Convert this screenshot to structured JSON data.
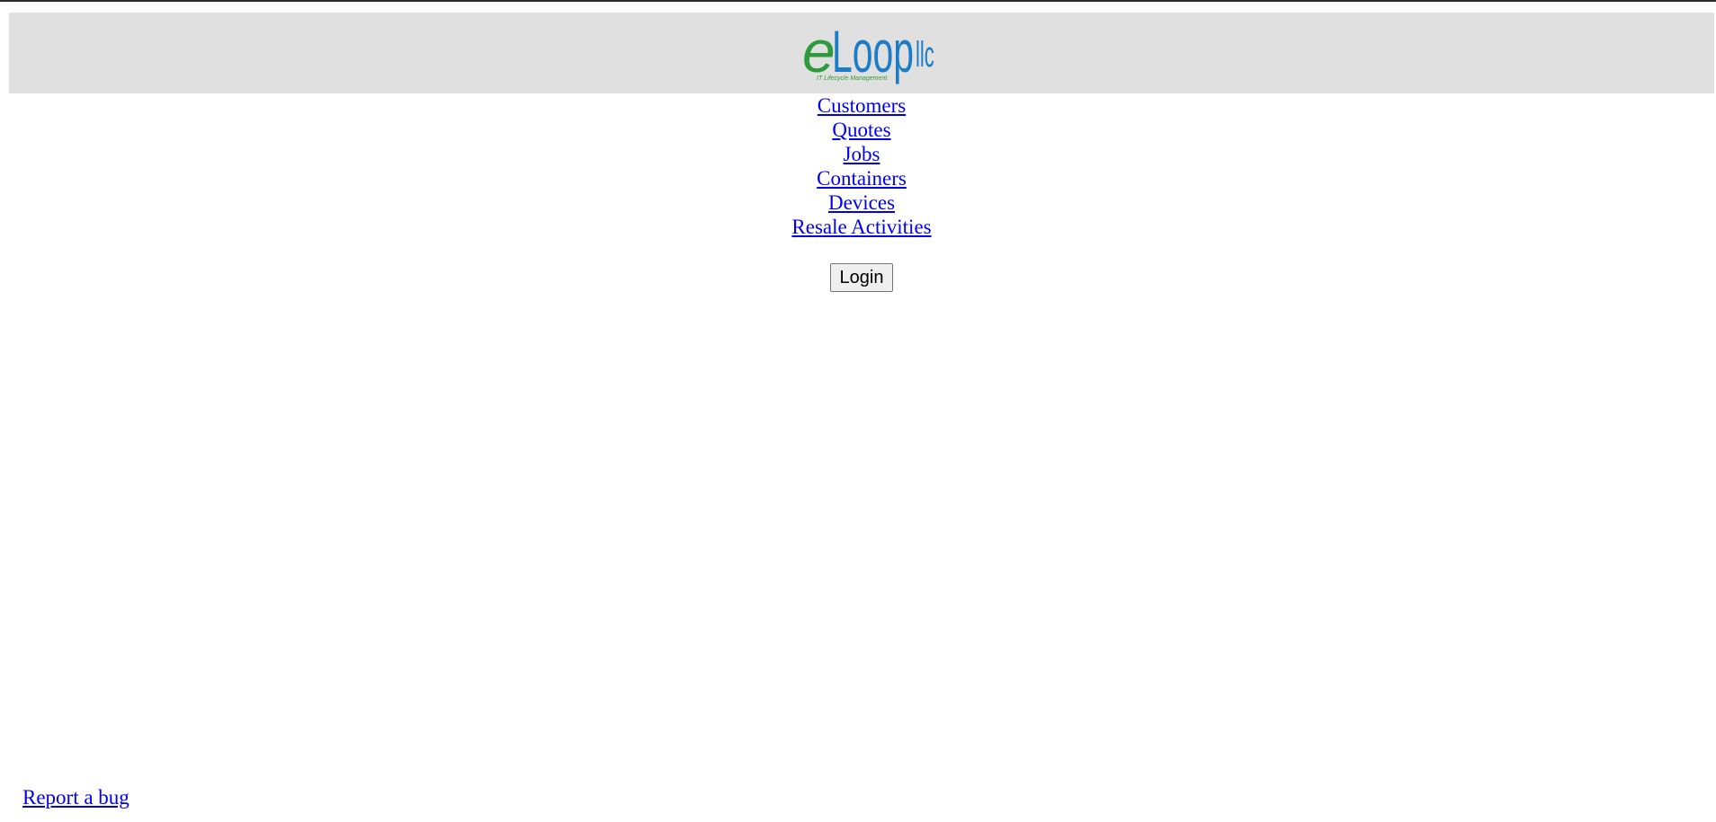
{
  "header": {
    "logo": {
      "wordmark_e": "e",
      "wordmark_loop": "Loop",
      "wordmark_llc": "llc",
      "tagline": "IT Lifecycle Management",
      "green": "#2e9a3e",
      "blue": "#1c7cc6",
      "icon": "eloop-logo"
    }
  },
  "nav": {
    "items": [
      {
        "label": "Customers"
      },
      {
        "label": "Quotes"
      },
      {
        "label": "Jobs"
      },
      {
        "label": "Containers"
      },
      {
        "label": "Devices"
      },
      {
        "label": "Resale Activities"
      }
    ]
  },
  "auth": {
    "login_label": "Login"
  },
  "footer": {
    "report_label": "Report a bug"
  },
  "colors": {
    "link": "#0000ee",
    "header_bg": "#e0e0e0"
  }
}
